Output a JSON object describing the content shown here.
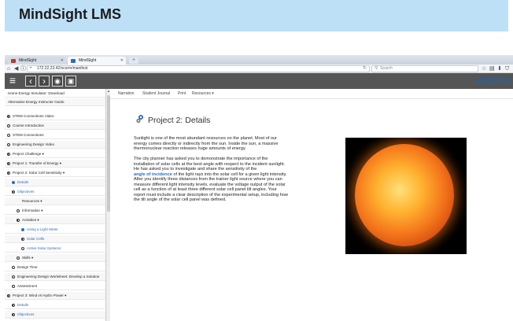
{
  "banner": {
    "title": "MindSight LMS"
  },
  "browser": {
    "tabs": [
      {
        "label": "MindSight"
      },
      {
        "label": "MindSight"
      }
    ],
    "new_tab": "+",
    "url": "172.22.23.42/scorm/manifest",
    "search_placeholder": "Search"
  },
  "toolbar": {
    "brand": "FESTO",
    "icons": [
      "menu-icon",
      "chevron-left-icon",
      "chevron-right-icon",
      "chat-icon",
      "save-icon"
    ]
  },
  "sidebar": {
    "items": [
      {
        "label": "Home Energy Simulator: Download"
      },
      {
        "label": "Alternative Energy Instructor Guide"
      },
      {
        "label": "STEM Connections Video"
      },
      {
        "label": "Course Introduction"
      },
      {
        "label": "STEM Connections"
      },
      {
        "label": "Engineering Design Video"
      },
      {
        "label": "Project Challenge ▾"
      },
      {
        "label": "Project 1: Transfer of Energy ▾"
      },
      {
        "label": "Project 2: Solar Cell Sensitivity ▾"
      },
      {
        "label": "Details"
      },
      {
        "label": "Objectives"
      },
      {
        "label": "Resources ▾"
      },
      {
        "label": "Information ▾"
      },
      {
        "label": "Activities ▾"
      },
      {
        "label": "Using a Light Meter"
      },
      {
        "label": "Solar Cells"
      },
      {
        "label": "Active Solar Systems"
      },
      {
        "label": "Skills ▾"
      },
      {
        "label": "Design Time"
      },
      {
        "label": "Engineering Design Worksheet: Develop a Solution"
      },
      {
        "label": "Assessment"
      },
      {
        "label": "Project 3: Wind vs Hydro Power ▾"
      },
      {
        "label": "Details"
      },
      {
        "label": "Objectives"
      }
    ]
  },
  "menu": {
    "items": [
      "Narration",
      "Student Journal",
      "Print",
      "Resources ▾"
    ]
  },
  "content": {
    "title": "Project 2: Details",
    "paragraph1": "Sunlight is one of the most abundant resources on the planet. Most of our\nenergy comes directly or indirectly from the sun. Inside the sun, a massive\nthermonuclear reaction releases huge amounts of energy.",
    "paragraph2_a": "The city planner has asked you to demonstrate the importance of the\ninstallation of solar cells at the best angle with respect to the incident sunlight.\nHe has asked you to investigate and share the sensitivity of the\n",
    "paragraph2_link": "angle of incidence",
    "paragraph2_b": " of the light rays into the solar cell for a given light intensity.\nAfter you identify three distances from the trainer light source where you can\nmeasure different light intensity levels, evaluate the voltage output of the solar\ncell as a function of at least three different solar cell panel tilt angles. Your\nreport must include a clear description of the experimental setup, including how\nthe tilt angle of the solar cell panel was defined."
  }
}
